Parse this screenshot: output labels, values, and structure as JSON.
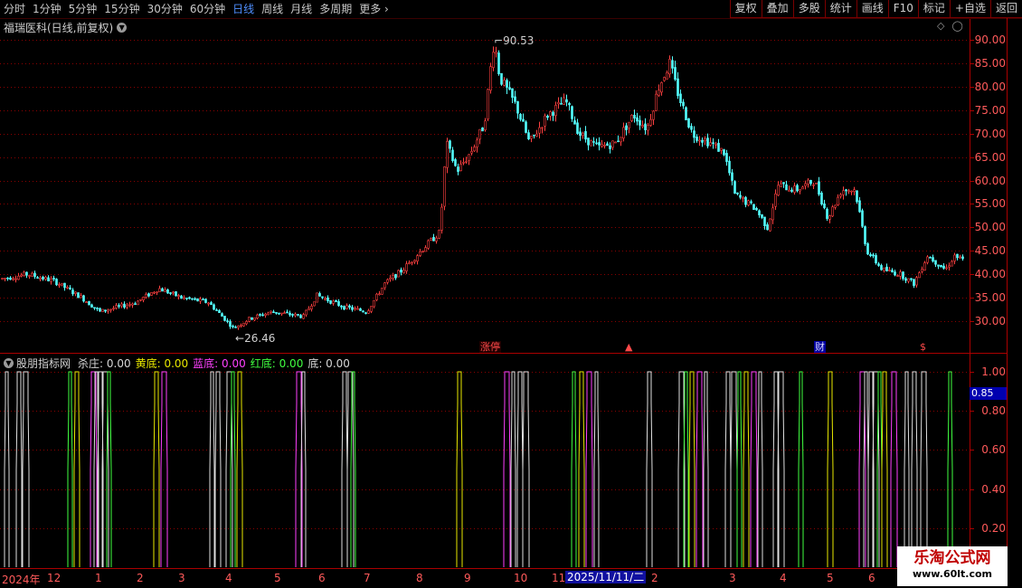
{
  "toolbar": {
    "period_tabs": [
      "分时",
      "1分钟",
      "5分钟",
      "15分钟",
      "30分钟",
      "60分钟",
      "日线",
      "周线",
      "月线",
      "多周期",
      "更多"
    ],
    "active_tab": "日线",
    "right_buttons": [
      "复权",
      "叠加",
      "多股",
      "统计",
      "画线",
      "F10",
      "标记",
      "+自选",
      "返回"
    ]
  },
  "main_chart": {
    "title": "福瑞医科(日线,前复权)",
    "price_ticks": [
      "90.00",
      "85.00",
      "80.00",
      "75.00",
      "70.00",
      "65.00",
      "60.00",
      "55.00",
      "50.00",
      "45.00",
      "40.00",
      "35.00",
      "30.00"
    ],
    "high_label": "90.53",
    "low_label": "26.46",
    "markers": {
      "limit_up": "涨停",
      "up_arrow": "▲",
      "finance": "财",
      "dollar": "$"
    }
  },
  "indicator": {
    "name": "股朋指标网",
    "items": [
      {
        "label": "杀庄:",
        "value": "0.00",
        "color": "#d8d8d8"
      },
      {
        "label": "黄底:",
        "value": "0.00",
        "color": "#e8e800"
      },
      {
        "label": "蓝底:",
        "value": "0.00",
        "color": "#ff40ff"
      },
      {
        "label": "红底:",
        "value": "0.00",
        "color": "#40ff40"
      },
      {
        "label": "底:",
        "value": "0.00",
        "color": "#d8d8d8"
      }
    ],
    "ticks": [
      "1.00",
      "0.80",
      "0.60",
      "0.40",
      "0.20"
    ],
    "current_value": "0.85"
  },
  "date_axis": {
    "labels": [
      "2024年",
      "12",
      "1",
      "2",
      "3",
      "4",
      "5",
      "6",
      "7",
      "8",
      "9",
      "10",
      "11",
      "2",
      "3",
      "4",
      "5",
      "6"
    ],
    "cursor": "2025/11/11/二"
  },
  "watermark": {
    "name": "乐淘公式网",
    "url": "www.60lt.com"
  },
  "colors": {
    "up": "#ff4040",
    "down": "#54ffff",
    "axis": "#ff5a5a",
    "grid": "#8a0000",
    "active_tab": "#4f8fff"
  }
}
